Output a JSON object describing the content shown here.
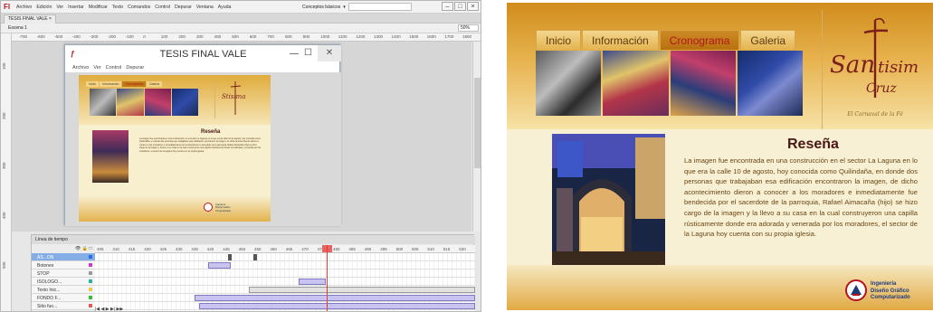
{
  "ide": {
    "app_logo": "Fl",
    "menu": [
      "Archivo",
      "Edición",
      "Ver",
      "Insertar",
      "Modificar",
      "Texto",
      "Comandos",
      "Control",
      "Depurar",
      "Ventana",
      "Ayuda"
    ],
    "workspace_label": "Conceptos básicos",
    "document_tab": "TESIS FINAL VALE",
    "scene_label": "Escena 1",
    "zoom": "50%",
    "ruler_top": [
      "-700",
      "-600",
      "-500",
      "-400",
      "-300",
      "-200",
      "-100",
      "0",
      "100",
      "200",
      "300",
      "400",
      "500",
      "600",
      "700",
      "800",
      "900",
      "1000",
      "1100",
      "1200",
      "1300",
      "1400",
      "1500",
      "1600",
      "1700",
      "1800"
    ],
    "ruler_left": [
      "100",
      "200",
      "300",
      "400",
      "500"
    ],
    "test_window": {
      "title": "TESIS FINAL VALE",
      "menu": [
        "Archivo",
        "Ver",
        "Control",
        "Depurar"
      ]
    },
    "timeline": {
      "title": "Línea de tiempo",
      "frame_numbers": [
        "405",
        "410",
        "415",
        "420",
        "425",
        "430",
        "435",
        "440",
        "445",
        "450",
        "455",
        "460",
        "465",
        "470",
        "475",
        "480",
        "485",
        "490",
        "495",
        "500",
        "505",
        "510",
        "515",
        "520"
      ],
      "layers": [
        "AS...ON",
        "Botones",
        "STOP",
        "ISOLOGO...",
        "Texto Inic...",
        "FONDO F...",
        "Sitio fuo..."
      ]
    }
  },
  "site": {
    "nav": [
      "Inicio",
      "Información",
      "Cronograma",
      "Galeria"
    ],
    "active_tab": "Cronograma",
    "brand_name_a": "San",
    "brand_name_b": "tisima",
    "brand_name_c": "Cruz",
    "brand_tagline": "El Carnaval de la Fé",
    "section_title": "Reseña",
    "section_text": "La imagen fue encontrada en una construcción en el sector La Laguna en lo que era la calle 10 de agosto, hoy conocida como Quilindaña, en donde dos personas que trabajaban esa edificación encontraron la imagen, de dicho acontecimiento dieron a conocer a los moradores e inmediatamente fue bendecida por el sacerdote de la parroquia, Rafael Aimacaña (hijo) se hizo cargo de la imagen y la llevo a su casa en la cual construyeron una capilla rústicamente donde era adorada y venerada por los moradores, el sector de la Laguna hoy cuenta con su propia iglesia.",
    "footer_lines": [
      "Ingeniería",
      "Diseño Gráfico",
      "Computarizado"
    ]
  },
  "colors": {
    "accent_red": "#b3141c",
    "gold": "#d18d1c",
    "text_brown": "#6a4614"
  }
}
